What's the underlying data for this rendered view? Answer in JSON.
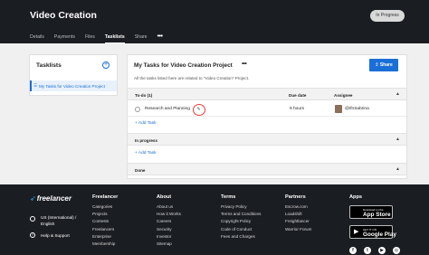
{
  "header": {
    "title": "Video Creation",
    "status": "In Progress",
    "tabs": [
      {
        "label": "Details"
      },
      {
        "label": "Payments"
      },
      {
        "label": "Files"
      },
      {
        "label": "Tasklists"
      },
      {
        "label": "Share"
      }
    ],
    "more_icon": "more-horizontal-icon"
  },
  "sidebar": {
    "heading": "Tasklists",
    "add_icon": "plus-circle-icon",
    "items": [
      {
        "label": "My Tasks for Video Creation Project",
        "icon": "list-icon"
      }
    ]
  },
  "main": {
    "title": "My Tasks for Video Creation Project",
    "subtitle": "All the tasks listed here are related to \"Video Creation\" Project.",
    "share_label": "Share",
    "columns": {
      "due": "Due date",
      "assignee": "Assignee"
    },
    "sections": [
      {
        "label": "To-do (1)",
        "tasks": [
          {
            "name": "Research and Planning",
            "due": "9 hours",
            "assignee": "@IfnSabrina"
          }
        ],
        "add_label": "Add Task"
      },
      {
        "label": "In progress",
        "add_label": "Add Task"
      },
      {
        "label": "Done"
      }
    ]
  },
  "footer": {
    "logo": "freelancer",
    "language": [
      "US (International) /",
      "English"
    ],
    "help": "Help & Support",
    "columns": [
      {
        "heading": "Freelancer",
        "links": [
          "Categories",
          "Projects",
          "Contests",
          "Freelancers",
          "Enterprise",
          "Membership"
        ]
      },
      {
        "heading": "About",
        "links": [
          "About us",
          "How it Works",
          "Careers",
          "Security",
          "Investor",
          "Sitemap"
        ]
      },
      {
        "heading": "Terms",
        "links": [
          "Privacy Policy",
          "Terms and Conditions",
          "Copyright Policy",
          "Code of Conduct",
          "Fees and Charges"
        ]
      },
      {
        "heading": "Partners",
        "links": [
          "Escrow.com",
          "Loadshift",
          "Freightlancer",
          "Warrior Forum"
        ]
      },
      {
        "heading": "Apps",
        "links": []
      }
    ],
    "app_store": {
      "small": "Download on the",
      "big": "App Store"
    },
    "google_play": {
      "small": "GET IT ON",
      "big": "Google Play"
    },
    "social_icons": [
      "facebook-icon",
      "twitter-icon",
      "youtube-icon",
      "instagram-icon"
    ]
  },
  "colors": {
    "accent": "#1a6fd6",
    "dark": "#1a1d22",
    "highlight": "#e0403a",
    "logo_blue": "#29b2fe"
  }
}
